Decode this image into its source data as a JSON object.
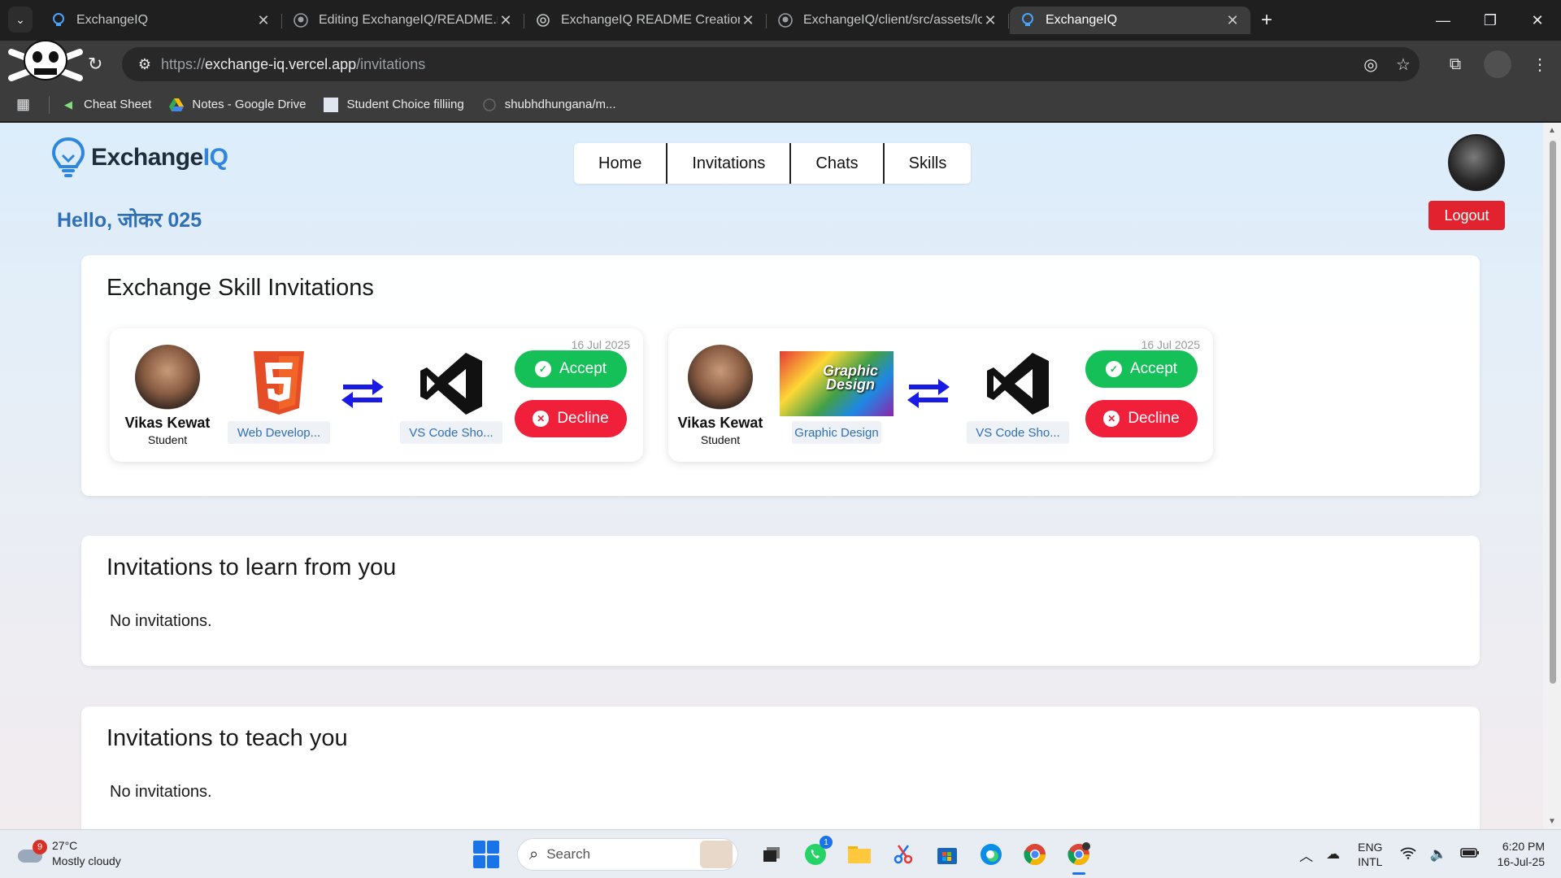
{
  "browser": {
    "tabs": [
      {
        "title": "ExchangeIQ",
        "icon": "bulb-icon",
        "active": false
      },
      {
        "title": "Editing ExchangeIQ/README.m",
        "icon": "github-icon",
        "active": false
      },
      {
        "title": "ExchangeIQ README Creation",
        "icon": "openai-icon",
        "active": false
      },
      {
        "title": "ExchangeIQ/client/src/assets/lo",
        "icon": "github-icon",
        "active": false
      },
      {
        "title": "ExchangeIQ",
        "icon": "bulb-icon",
        "active": true
      }
    ],
    "url_prefix": "https://",
    "url_domain": "exchange-iq.vercel.app",
    "url_path": "/invitations",
    "bookmarks": [
      {
        "label": "Cheat Sheet"
      },
      {
        "label": "Notes - Google Drive"
      },
      {
        "label": "Student Choice filliing"
      },
      {
        "label": "shubhdhungana/m..."
      }
    ]
  },
  "header": {
    "brand_main": "Exchange",
    "brand_accent": "IQ",
    "nav": [
      "Home",
      "Invitations",
      "Chats",
      "Skills"
    ],
    "logout_label": "Logout",
    "greeting": "Hello, जोकर 025"
  },
  "exchange_section": {
    "title": "Exchange Skill Invitations",
    "cards": [
      {
        "date": "16 Jul 2025",
        "user_name": "Vikas Kewat",
        "user_role": "Student",
        "offer_skill": "Web Develop...",
        "want_skill": "VS Code Sho...",
        "accept_label": "Accept",
        "decline_label": "Decline"
      },
      {
        "date": "16 Jul 2025",
        "user_name": "Vikas Kewat",
        "user_role": "Student",
        "offer_skill": "Graphic Design",
        "offer_image_text": "Graphic Design",
        "want_skill": "VS Code Sho...",
        "accept_label": "Accept",
        "decline_label": "Decline"
      }
    ]
  },
  "learn_section": {
    "title": "Invitations to learn from you",
    "empty": "No invitations."
  },
  "teach_section": {
    "title": "Invitations to teach you",
    "empty": "No invitations."
  },
  "taskbar": {
    "weather_badge": "9",
    "temperature": "27°C",
    "weather_desc": "Mostly cloudy",
    "search_label": "Search",
    "whatsapp_badge": "1",
    "lang_top": "ENG",
    "lang_bottom": "INTL",
    "time": "6:20 PM",
    "date": "16-Jul-25"
  },
  "colors": {
    "brand_blue": "#2e86de",
    "greeting_blue": "#2f6fb8",
    "accept_green": "#16c058",
    "decline_red": "#f0203a",
    "logout_red": "#e2222e"
  }
}
